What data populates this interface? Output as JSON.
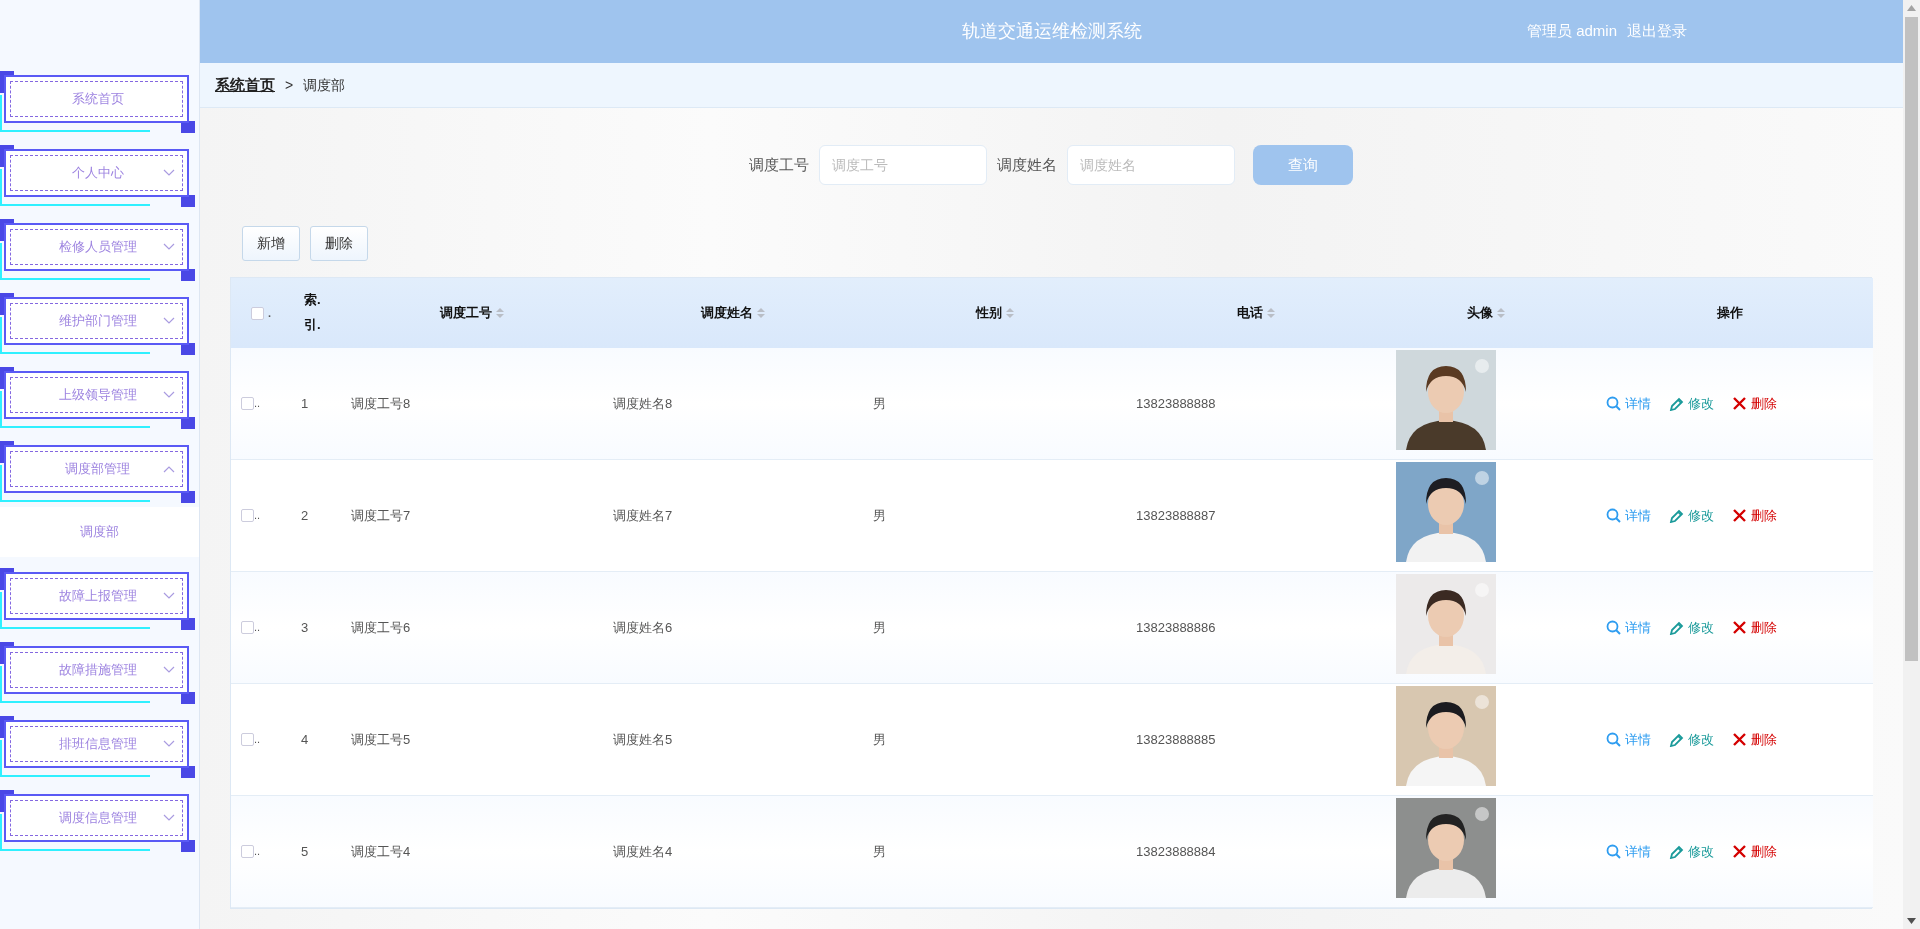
{
  "header": {
    "title": "轨道交通运维检测系统",
    "user": "管理员 admin",
    "logout": "退出登录"
  },
  "sidebar": {
    "items": [
      {
        "label": "系统首页",
        "kind": "link"
      },
      {
        "label": "个人中心",
        "kind": "menu",
        "expanded": false
      },
      {
        "label": "检修人员管理",
        "kind": "menu",
        "expanded": false
      },
      {
        "label": "维护部门管理",
        "kind": "menu",
        "expanded": false
      },
      {
        "label": "上级领导管理",
        "kind": "menu",
        "expanded": false
      },
      {
        "label": "调度部管理",
        "kind": "menu",
        "expanded": true,
        "children": [
          {
            "label": "调度部"
          }
        ]
      },
      {
        "label": "故障上报管理",
        "kind": "menu",
        "expanded": false
      },
      {
        "label": "故障措施管理",
        "kind": "menu",
        "expanded": false
      },
      {
        "label": "排班信息管理",
        "kind": "menu",
        "expanded": false
      },
      {
        "label": "调度信息管理",
        "kind": "menu",
        "expanded": false
      }
    ]
  },
  "breadcrumb": {
    "home": "系统首页",
    "separator": ">",
    "current": "调度部"
  },
  "search": {
    "fields": [
      {
        "label": "调度工号",
        "placeholder": "调度工号"
      },
      {
        "label": "调度姓名",
        "placeholder": "调度姓名"
      }
    ],
    "button": "查询"
  },
  "toolbar": [
    "新增",
    "删除"
  ],
  "table": {
    "columns": [
      {
        "kind": "check",
        "label": ".",
        "checked": false
      },
      {
        "kind": "index",
        "label": "索.引.",
        "sortable": false
      },
      {
        "kind": "text",
        "label": "调度工号",
        "sortable": true
      },
      {
        "kind": "text",
        "label": "调度姓名",
        "sortable": true
      },
      {
        "kind": "text",
        "label": "性别",
        "sortable": true
      },
      {
        "kind": "text",
        "label": "电话",
        "sortable": true
      },
      {
        "kind": "avatar",
        "label": "头像",
        "sortable": true
      },
      {
        "kind": "actions",
        "label": "操作",
        "sortable": false
      }
    ],
    "rows": [
      {
        "checked": false,
        "check_text": "..",
        "cells": [
          "1",
          "调度工号8",
          "调度姓名8",
          "男",
          "13823888888"
        ],
        "actions": [
          {
            "kind": "view",
            "label": "详情"
          },
          {
            "kind": "edit",
            "label": "修改"
          },
          {
            "kind": "delete",
            "label": "删除"
          }
        ]
      },
      {
        "checked": false,
        "check_text": "..",
        "cells": [
          "2",
          "调度工号7",
          "调度姓名7",
          "男",
          "13823888887"
        ],
        "actions": [
          {
            "kind": "view",
            "label": "详情"
          },
          {
            "kind": "edit",
            "label": "修改"
          },
          {
            "kind": "delete",
            "label": "删除"
          }
        ]
      },
      {
        "checked": false,
        "check_text": "..",
        "cells": [
          "3",
          "调度工号6",
          "调度姓名6",
          "男",
          "13823888886"
        ],
        "actions": [
          {
            "kind": "view",
            "label": "详情"
          },
          {
            "kind": "edit",
            "label": "修改"
          },
          {
            "kind": "delete",
            "label": "删除"
          }
        ]
      },
      {
        "checked": false,
        "check_text": "..",
        "cells": [
          "4",
          "调度工号5",
          "调度姓名5",
          "男",
          "13823888885"
        ],
        "actions": [
          {
            "kind": "view",
            "label": "详情"
          },
          {
            "kind": "edit",
            "label": "修改"
          },
          {
            "kind": "delete",
            "label": "删除"
          }
        ]
      },
      {
        "checked": false,
        "check_text": "..",
        "cells": [
          "5",
          "调度工号4",
          "调度姓名4",
          "男",
          "13823888884"
        ],
        "actions": [
          {
            "kind": "view",
            "label": "详情"
          },
          {
            "kind": "edit",
            "label": "修改"
          },
          {
            "kind": "delete",
            "label": "删除"
          }
        ]
      }
    ]
  }
}
